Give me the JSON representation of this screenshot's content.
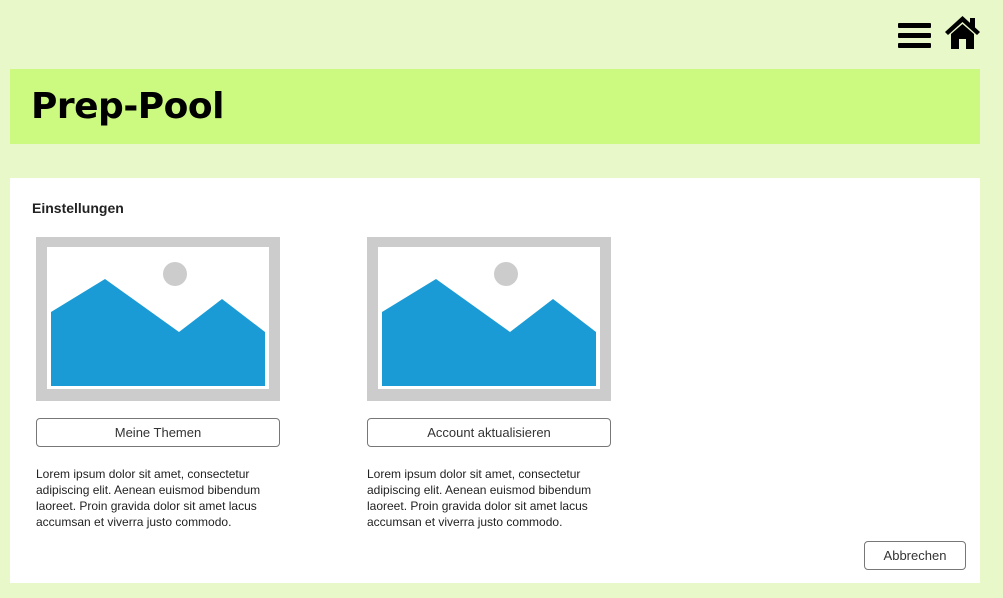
{
  "header": {
    "title": "Prep-Pool",
    "menu_icon": "hamburger-menu-icon",
    "home_icon": "home-icon"
  },
  "panel": {
    "title": "Einstellungen",
    "cards": [
      {
        "image_icon": "image-placeholder-icon",
        "button_label": "Meine Themen",
        "description": "Lorem ipsum dolor sit amet, consectetur adipiscing elit. Aenean euismod bibendum laoreet. Proin gravida dolor sit amet lacus accumsan et viverra justo commodo."
      },
      {
        "image_icon": "image-placeholder-icon",
        "button_label": "Account aktualisieren",
        "description": "Lorem ipsum dolor sit amet, consectetur adipiscing elit. Aenean euismod bibendum laoreet. Proin gravida dolor sit amet lacus accumsan et viverra justo commodo."
      }
    ],
    "cancel_label": "Abbrechen"
  },
  "colors": {
    "page_background": "#e9f8c9",
    "banner_background": "#ccf97f",
    "panel_background": "#ffffff",
    "placeholder_frame": "#cccccc",
    "placeholder_mountain": "#1a9bd6"
  }
}
